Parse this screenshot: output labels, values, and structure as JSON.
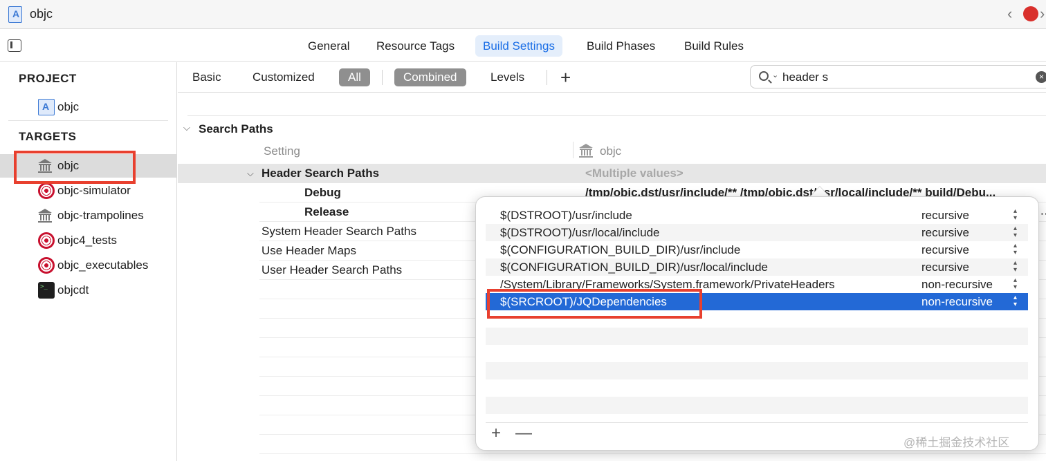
{
  "window": {
    "title": "objc"
  },
  "editor_tabs": [
    "General",
    "Resource Tags",
    "Build Settings",
    "Build Phases",
    "Build Rules"
  ],
  "sidebar": {
    "project_header": "PROJECT",
    "project_item": "objc",
    "targets_header": "TARGETS",
    "targets": [
      "objc",
      "objc-simulator",
      "objc-trampolines",
      "objc4_tests",
      "objc_executables",
      "objcdt"
    ]
  },
  "filter": {
    "basic": "Basic",
    "customized": "Customized",
    "all": "All",
    "combined": "Combined",
    "levels": "Levels",
    "add": "+",
    "search_value": "header s"
  },
  "settings": {
    "section": "Search Paths",
    "col_setting": "Setting",
    "col_target": "objc",
    "header_search_paths": "Header Search Paths",
    "multiple_values": "<Multiple values>",
    "debug": "Debug",
    "debug_value": "/tmp/objc.dst/usr/include/** /tmp/objc.dst/usr/local/include/** build/Debu...",
    "release": "Release",
    "system_header_search_paths": "System Header Search Paths",
    "use_header_maps": "Use Header Maps",
    "user_header_search_paths": "User Header Search Paths"
  },
  "popover": {
    "rows": [
      {
        "path": "$(DSTROOT)/usr/include",
        "mode": "recursive"
      },
      {
        "path": "$(DSTROOT)/usr/local/include",
        "mode": "recursive"
      },
      {
        "path": "$(CONFIGURATION_BUILD_DIR)/usr/include",
        "mode": "recursive"
      },
      {
        "path": "$(CONFIGURATION_BUILD_DIR)/usr/local/include",
        "mode": "recursive"
      },
      {
        "path": "/System/Library/Frameworks/System.framework/PrivateHeaders",
        "mode": "non-recursive"
      },
      {
        "path": "$(SRCROOT)/JQDependencies",
        "mode": "non-recursive"
      }
    ],
    "add": "+",
    "remove": "—"
  },
  "watermark": "@稀土掘金技术社区",
  "colors": {
    "accent": "#2369d6",
    "annotation": "#e8402f",
    "selected_tab": "#1a6ee6"
  }
}
